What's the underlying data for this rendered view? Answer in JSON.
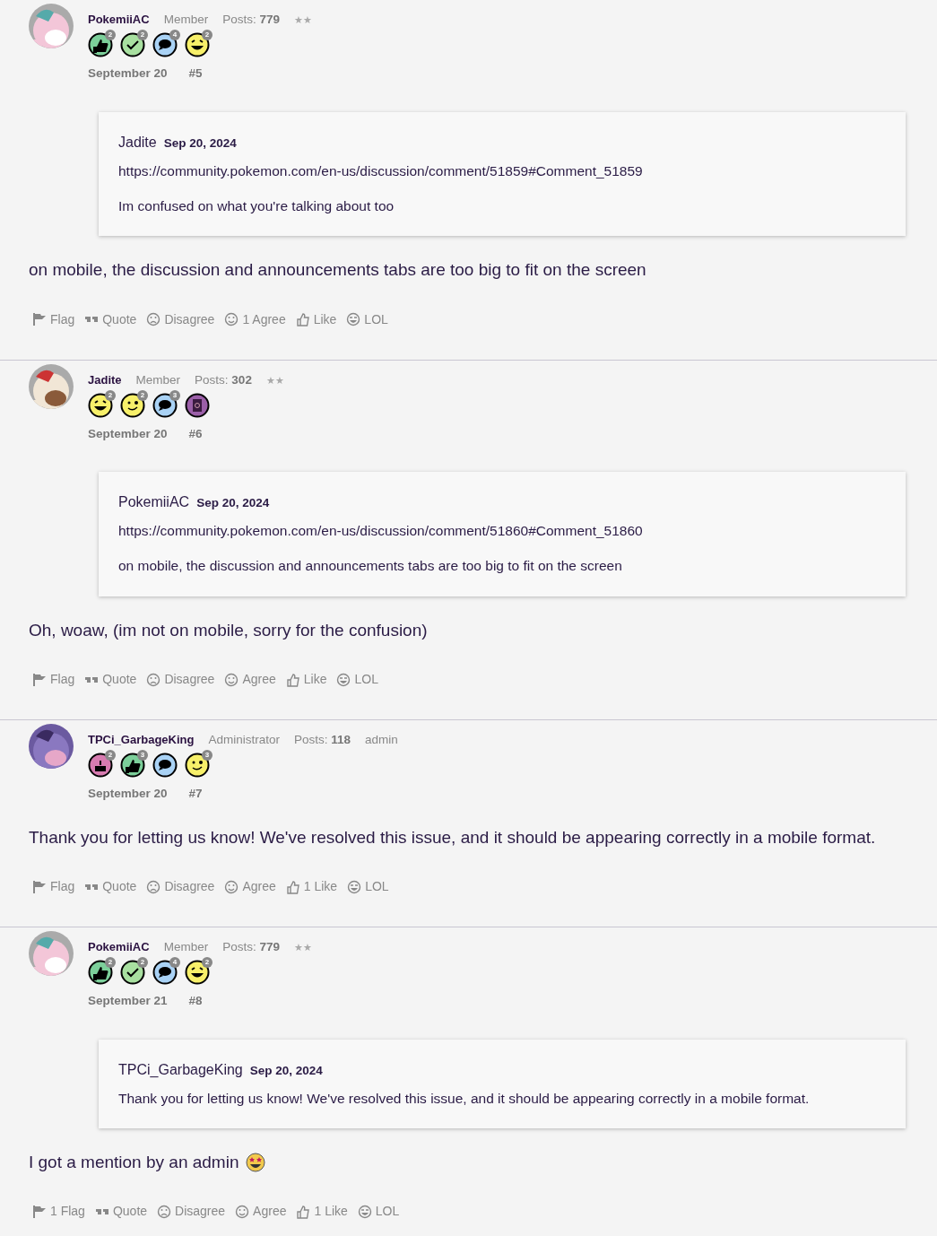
{
  "posts": [
    {
      "author": "PokemiiAC",
      "role": "Member",
      "posts_label": "Posts:",
      "posts_count": "779",
      "rank": "★★",
      "badges": [
        {
          "kind": "thumb",
          "color": "#7ccf9a",
          "count": "2"
        },
        {
          "kind": "check",
          "color": "#a8e0a0",
          "count": "2"
        },
        {
          "kind": "chat",
          "color": "#a9d2f5",
          "count": "4"
        },
        {
          "kind": "laugh",
          "color": "#f7f06a",
          "count": "2"
        }
      ],
      "date": "September 20",
      "number": "#5",
      "quote": {
        "author": "Jadite",
        "date": "Sep 20, 2024",
        "link": "https://community.pokemon.com/en-us/discussion/comment/51859#Comment_51859",
        "text": "Im confused on what you're talking about too"
      },
      "body": "on mobile, the discussion and announcements tabs are too big to fit on the screen",
      "emoji": false,
      "reactions": [
        {
          "kind": "flag",
          "label": "Flag"
        },
        {
          "kind": "quote",
          "label": "Quote"
        },
        {
          "kind": "disagree",
          "label": "Disagree"
        },
        {
          "kind": "agree",
          "label": "1 Agree"
        },
        {
          "kind": "like",
          "label": "Like"
        },
        {
          "kind": "lol",
          "label": "LOL"
        }
      ]
    },
    {
      "author": "Jadite",
      "role": "Member",
      "posts_label": "Posts:",
      "posts_count": "302",
      "rank": "★★",
      "badges": [
        {
          "kind": "laugh",
          "color": "#f7f06a",
          "count": "2"
        },
        {
          "kind": "wink",
          "color": "#f7f06a",
          "count": "2"
        },
        {
          "kind": "chat",
          "color": "#a9d2f5",
          "count": "3"
        },
        {
          "kind": "book",
          "color": "#9b5fa8"
        }
      ],
      "date": "September 20",
      "number": "#6",
      "quote": {
        "author": "PokemiiAC",
        "date": "Sep 20, 2024",
        "link": "https://community.pokemon.com/en-us/discussion/comment/51860#Comment_51860",
        "text": "on mobile, the discussion and announcements tabs are too big to fit on the screen"
      },
      "body": "Oh, woaw, (im not on mobile, sorry for the confusion)",
      "emoji": false,
      "reactions": [
        {
          "kind": "flag",
          "label": "Flag"
        },
        {
          "kind": "quote",
          "label": "Quote"
        },
        {
          "kind": "disagree",
          "label": "Disagree"
        },
        {
          "kind": "agree",
          "label": "Agree"
        },
        {
          "kind": "like",
          "label": "Like"
        },
        {
          "kind": "lol",
          "label": "LOL"
        }
      ]
    },
    {
      "author": "TPCi_GarbageKing",
      "role": "Administrator",
      "posts_label": "Posts:",
      "posts_count": "118",
      "rank": "admin",
      "badges": [
        {
          "kind": "cake",
          "color": "#d77bb0",
          "count": "2"
        },
        {
          "kind": "thumb",
          "color": "#7ccf9a",
          "count": "3"
        },
        {
          "kind": "chat",
          "color": "#a9d2f5"
        },
        {
          "kind": "wink",
          "color": "#f7f06a",
          "count": "3"
        }
      ],
      "date": "September 20",
      "number": "#7",
      "body": "Thank you for letting us know! We've resolved this issue, and it should be appearing correctly in a mobile format.",
      "emoji": false,
      "reactions": [
        {
          "kind": "flag",
          "label": "Flag"
        },
        {
          "kind": "quote",
          "label": "Quote"
        },
        {
          "kind": "disagree",
          "label": "Disagree"
        },
        {
          "kind": "agree",
          "label": "Agree"
        },
        {
          "kind": "like",
          "label": "1 Like"
        },
        {
          "kind": "lol",
          "label": "LOL"
        }
      ]
    },
    {
      "author": "PokemiiAC",
      "role": "Member",
      "posts_label": "Posts:",
      "posts_count": "779",
      "rank": "★★",
      "badges": [
        {
          "kind": "thumb",
          "color": "#7ccf9a",
          "count": "2"
        },
        {
          "kind": "check",
          "color": "#a8e0a0",
          "count": "2"
        },
        {
          "kind": "chat",
          "color": "#a9d2f5",
          "count": "4"
        },
        {
          "kind": "laugh",
          "color": "#f7f06a",
          "count": "2"
        }
      ],
      "date": "September 21",
      "number": "#8",
      "quote": {
        "author": "TPCi_GarbageKing",
        "date": "Sep 20, 2024",
        "text": "Thank you for letting us know! We've resolved this issue, and it should be appearing correctly in a mobile format."
      },
      "body": "I got a mention by an admin",
      "emoji": true,
      "reactions": [
        {
          "kind": "flag",
          "label": "1 Flag"
        },
        {
          "kind": "quote",
          "label": "Quote"
        },
        {
          "kind": "disagree",
          "label": "Disagree"
        },
        {
          "kind": "agree",
          "label": "Agree"
        },
        {
          "kind": "like",
          "label": "1 Like"
        },
        {
          "kind": "lol",
          "label": "LOL"
        }
      ]
    }
  ]
}
